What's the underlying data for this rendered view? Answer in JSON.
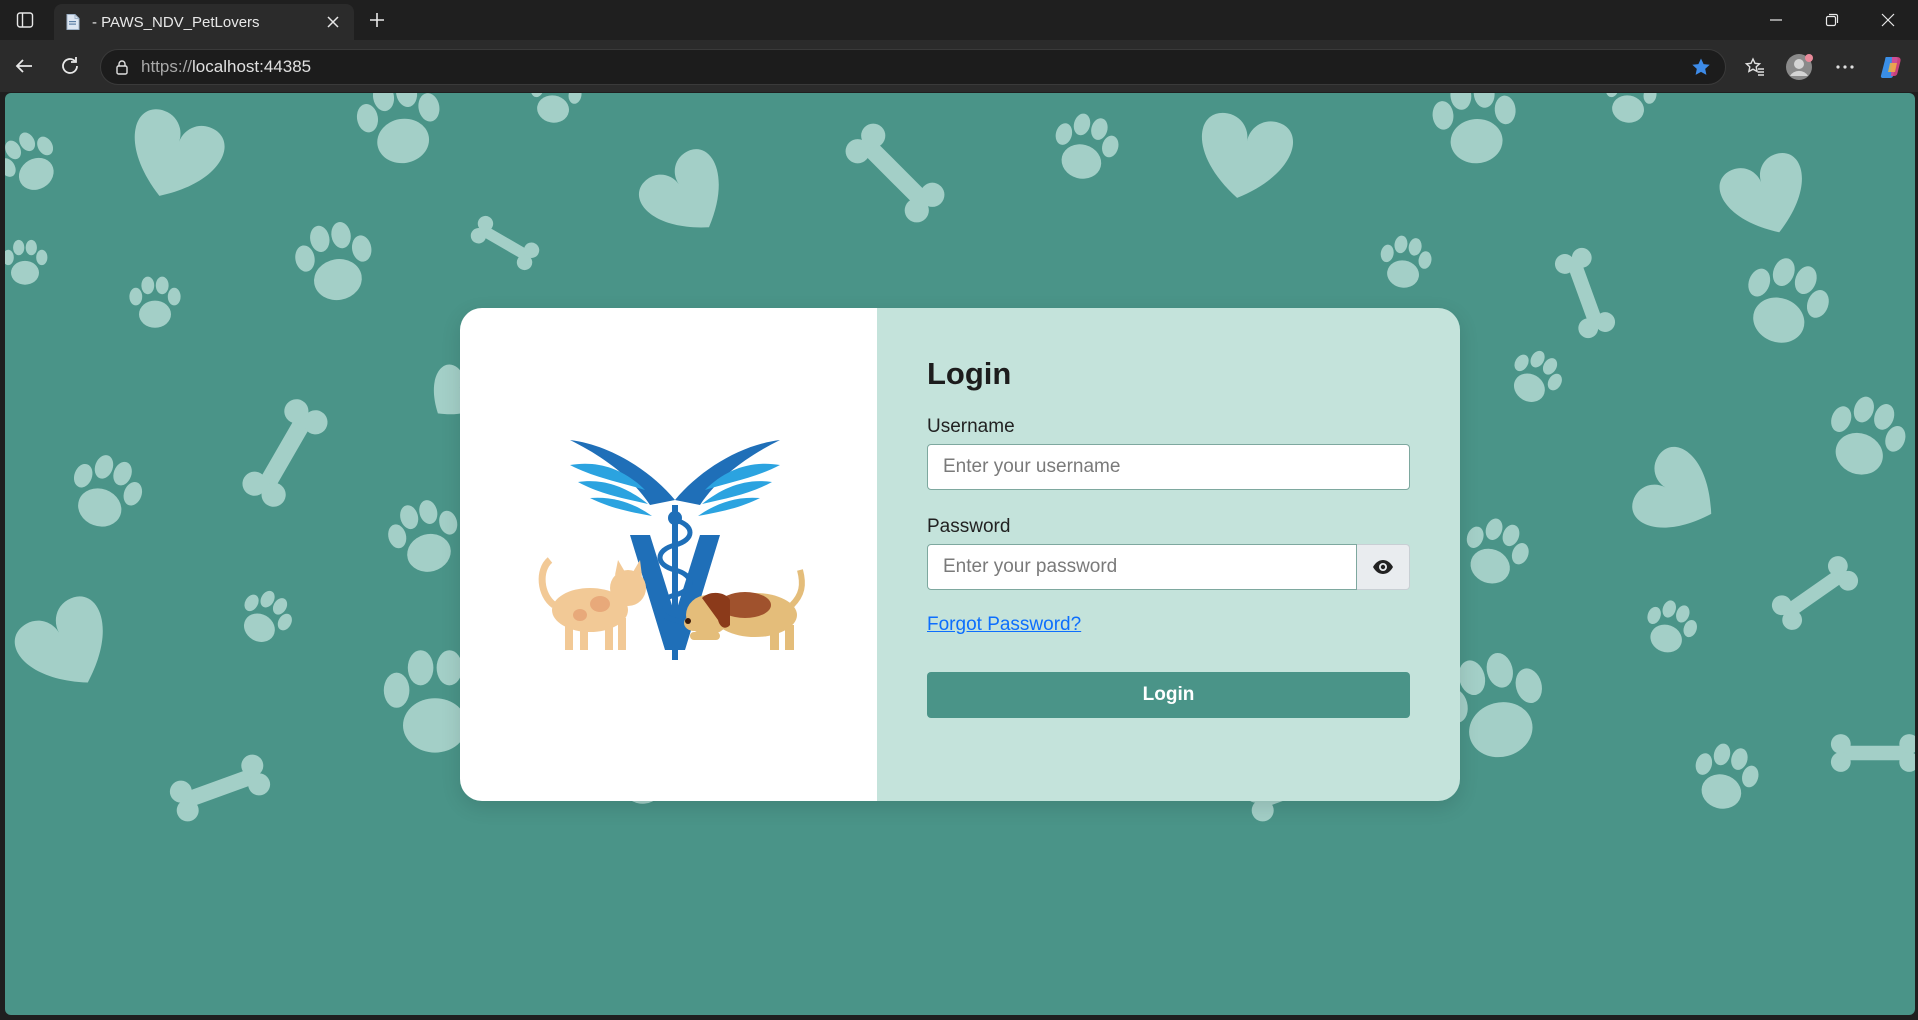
{
  "browser": {
    "tab_title": "- PAWS_NDV_PetLovers",
    "url_protocol": "https://",
    "url_host": "localhost:44385"
  },
  "login": {
    "heading": "Login",
    "username_label": "Username",
    "username_placeholder": "Enter your username",
    "password_label": "Password",
    "password_placeholder": "Enter your password",
    "forgot_link": "Forgot Password?",
    "submit_label": "Login"
  },
  "colors": {
    "page_background": "#4a9488",
    "pattern": "#a3cfc7",
    "card_right": "#c4e3db",
    "button": "#4a9488",
    "link": "#0d6efd",
    "logo_blue": "#1f6fb8"
  },
  "icons": [
    "sidebar-toggle-icon",
    "file-icon",
    "close-icon",
    "plus-icon",
    "minimize-icon",
    "restore-icon",
    "back-icon",
    "reload-icon",
    "lock-icon",
    "star-icon",
    "favorites-icon",
    "profile-icon",
    "more-icon",
    "copilot-icon",
    "eye-icon"
  ]
}
